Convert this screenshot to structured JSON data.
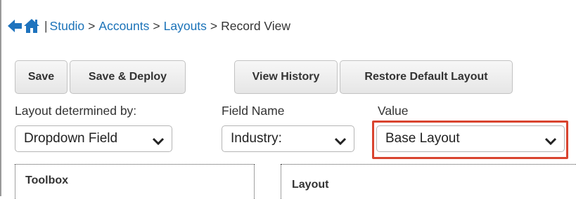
{
  "breadcrumb": {
    "separator": "|",
    "links": [
      "Studio",
      "Accounts",
      "Layouts"
    ],
    "arrow": ">",
    "current": "Record View"
  },
  "buttons": {
    "save": "Save",
    "save_deploy": "Save & Deploy",
    "view_history": "View History",
    "restore_default": "Restore Default Layout"
  },
  "labels": {
    "layout_determined_by": "Layout determined by:",
    "field_name": "Field Name",
    "value": "Value"
  },
  "selects": {
    "layout_determined_by": "Dropdown Field",
    "field_name": "Industry:",
    "value": "Base Layout"
  },
  "panels": {
    "toolbox": "Toolbox",
    "layout": "Layout"
  },
  "colors": {
    "link": "#1a72b8",
    "highlight": "#d9442f",
    "icon_blue": "#1e73be"
  }
}
